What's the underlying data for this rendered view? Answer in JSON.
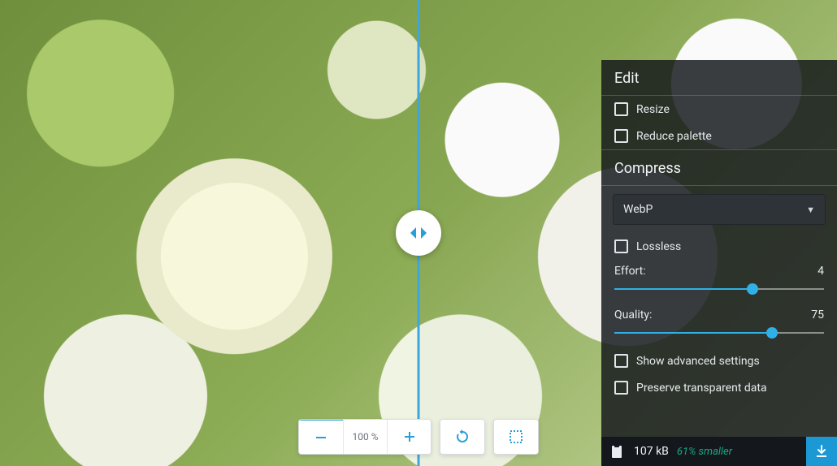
{
  "zoom": {
    "display": "100 %"
  },
  "panel": {
    "edit_title": "Edit",
    "resize_label": "Resize",
    "reduce_palette_label": "Reduce palette",
    "compress_title": "Compress",
    "format": {
      "selected": "WebP"
    },
    "lossless_label": "Lossless",
    "effort": {
      "label": "Effort:",
      "value": "4",
      "pct": 66
    },
    "quality": {
      "label": "Quality:",
      "value": "75",
      "pct": 75
    },
    "show_advanced_label": "Show advanced settings",
    "preserve_transparent_label": "Preserve transparent data"
  },
  "footer": {
    "size": "107 kB",
    "delta": "61% smaller"
  }
}
